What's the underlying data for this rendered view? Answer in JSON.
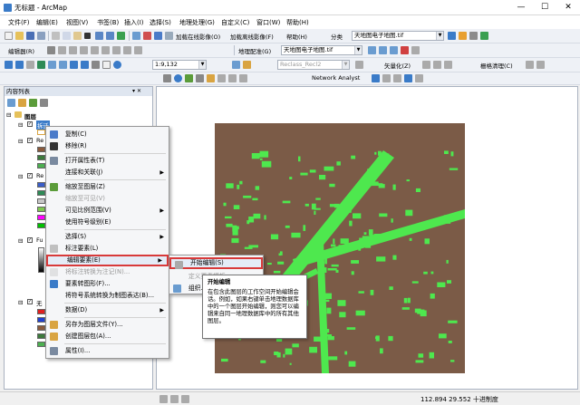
{
  "window": {
    "title": "无标题 - ArcMap",
    "minimize": "—",
    "maximize": "☐",
    "close": "✕"
  },
  "menubar": [
    "文件(F)",
    "编辑(E)",
    "视图(V)",
    "书签(B)",
    "插入(I)",
    "选择(S)",
    "地理处理(G)",
    "自定义(C)",
    "窗口(W)",
    "帮助(H)"
  ],
  "toolbar1": {
    "online_imagery": "加载在线影像(O)",
    "offline_imagery": "加载离线影像(F)",
    "help": "帮助(H)",
    "classify": "分类",
    "dataset": "天地图电子地图.tif"
  },
  "toolbar2": {
    "editor": "编辑器(R)",
    "georef": "地理配准(G)",
    "georef_layer": "天地图电子地图.tif",
    "scale": "1:9,132",
    "vectorize": "矢量化(Z)",
    "reclass_layer": "Reclass_Recl2",
    "raster_clean": "栅格清理(C)"
  },
  "toolbar3": {
    "network_analyst": "Network Analyst"
  },
  "toc": {
    "title": "内容列表",
    "root": "图层",
    "layers": [
      {
        "label": "拆迁",
        "selected": true
      },
      {
        "label": "Re"
      },
      {
        "label": "Re"
      },
      {
        "label": "Fu"
      },
      {
        "label": "无"
      }
    ],
    "swatches": [
      "#8b5a3c",
      "#3c7a3c",
      "#4caf50",
      "#3a5ec9",
      "#2e8b57",
      "#c8c8c8",
      "#7ec850",
      "#ff00ff",
      "#00c000",
      "#e02020",
      "#2040d0"
    ]
  },
  "context_menu": {
    "items": [
      {
        "label": "复制(C)",
        "icon": "copy-icon",
        "color": "#4a7bc9"
      },
      {
        "label": "移除(R)",
        "icon": "remove-icon",
        "color": "#333"
      },
      {
        "sep": true
      },
      {
        "label": "打开属性表(T)",
        "icon": "table-icon",
        "color": "#7a8aa0"
      },
      {
        "label": "连接和关联(J)",
        "submenu": true
      },
      {
        "sep": true
      },
      {
        "label": "缩放至图层(Z)",
        "icon": "zoom-layer-icon",
        "color": "#5b9c3a"
      },
      {
        "label": "缩放至可见(V)",
        "disabled": true
      },
      {
        "label": "可见比例范围(V)",
        "submenu": true
      },
      {
        "label": "使用符号级别(E)"
      },
      {
        "sep": true
      },
      {
        "label": "选择(S)",
        "submenu": true
      },
      {
        "label": "标注要素(L)",
        "icon": "label-icon",
        "color": "#c0c0c0"
      },
      {
        "label": "编辑要素(E)",
        "submenu": true,
        "highlight": true
      },
      {
        "label": "将标注转换为注记(N)...",
        "icon": "annotation-icon",
        "disabled": true
      },
      {
        "label": "要素转图形(F)...",
        "icon": "graphic-icon",
        "color": "#3a7bc8"
      },
      {
        "label": "将符号系统转换为制图表达(B)..."
      },
      {
        "sep": true
      },
      {
        "label": "数据(D)",
        "submenu": true
      },
      {
        "sep": true
      },
      {
        "label": "另存为图层文件(Y)...",
        "icon": "save-layer-icon",
        "color": "#d9a441"
      },
      {
        "label": "创建图层包(A)...",
        "icon": "layer-package-icon",
        "color": "#d9a441"
      },
      {
        "sep": true
      },
      {
        "label": "属性(I)...",
        "icon": "properties-icon",
        "color": "#7a8aa0"
      }
    ]
  },
  "submenu": {
    "items": [
      {
        "label": "开始编辑(S)",
        "highlight": true
      },
      {
        "label": "定义要素模板",
        "disabled": true
      },
      {
        "label": "组织..."
      }
    ]
  },
  "tooltip": {
    "title": "开始编辑",
    "body": "在包含此图层的工作空间开始编辑会话。例如，如果右键单击地理数据库中的一个图层开始编辑，则您可以编辑来自同一地理数据库中的所有其他图层。"
  },
  "status": {
    "coords": "112.894  29.552 十进制度"
  },
  "colors": {
    "raster_bg": "#7b5b47",
    "features": "#4ee84e"
  }
}
